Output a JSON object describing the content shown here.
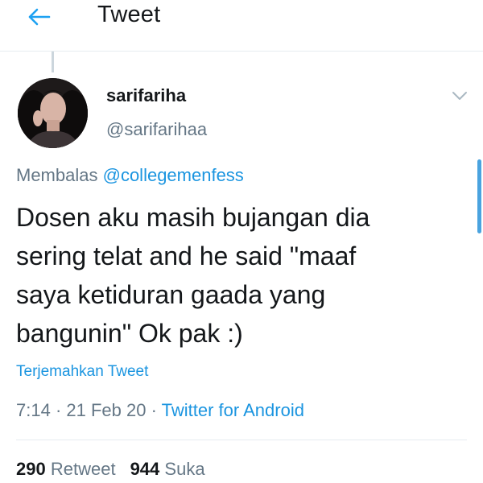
{
  "header": {
    "back_icon": "arrow-left-icon",
    "title": "Tweet"
  },
  "tweet": {
    "display_name": "sarifariha",
    "handle": "@sarifarihaa",
    "reply_prefix": "Membalas",
    "reply_mention": "@collegemenfess",
    "text_lines": [
      "Dosen aku masih bujangan dia",
      "sering telat and he said \"maaf",
      "saya ketiduran gaada yang",
      "bangunin\" Ok pak :)"
    ],
    "translate_label": "Terjemahkan Tweet",
    "time": "7:14",
    "separator": "·",
    "date": "21 Feb 20",
    "source": "Twitter for Android",
    "retweet_count": "290",
    "retweet_label": "Retweet",
    "like_count": "944",
    "like_label": "Suka"
  },
  "colors": {
    "accent": "#1b95e0",
    "secondary_text": "#657786",
    "primary_text": "#14171a",
    "divider": "#e6ecf0"
  }
}
